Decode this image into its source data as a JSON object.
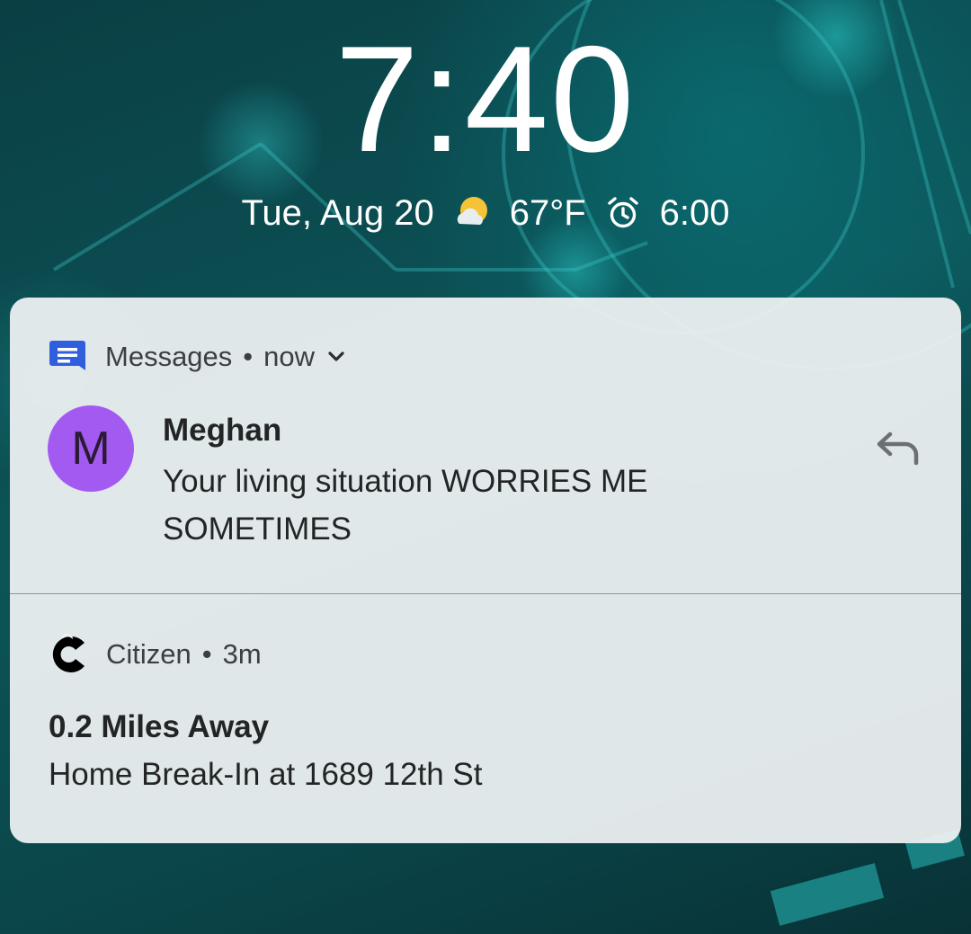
{
  "lockscreen": {
    "time": "7:40",
    "date": "Tue, Aug 20",
    "weather_icon": "partly-cloudy-icon",
    "temperature": "67°F",
    "alarm_icon": "alarm-clock-icon",
    "alarm_time": "6:00"
  },
  "notifications": {
    "messages": {
      "app_icon": "messages-app-icon",
      "app_name": "Messages",
      "separator": "•",
      "time": "now",
      "expand_icon": "chevron-down-icon",
      "avatar_letter": "M",
      "sender": "Meghan",
      "body": "Your living situation WORRIES ME SOMETIMES",
      "reply_icon": "reply-icon",
      "avatar_color": "#a35af0",
      "app_icon_color": "#2f5fdc"
    },
    "citizen": {
      "app_icon": "citizen-app-icon",
      "app_name": "Citizen",
      "separator": "•",
      "time": "3m",
      "title": "0.2 Miles Away",
      "body": "Home Break-In at 1689 12th St"
    }
  }
}
